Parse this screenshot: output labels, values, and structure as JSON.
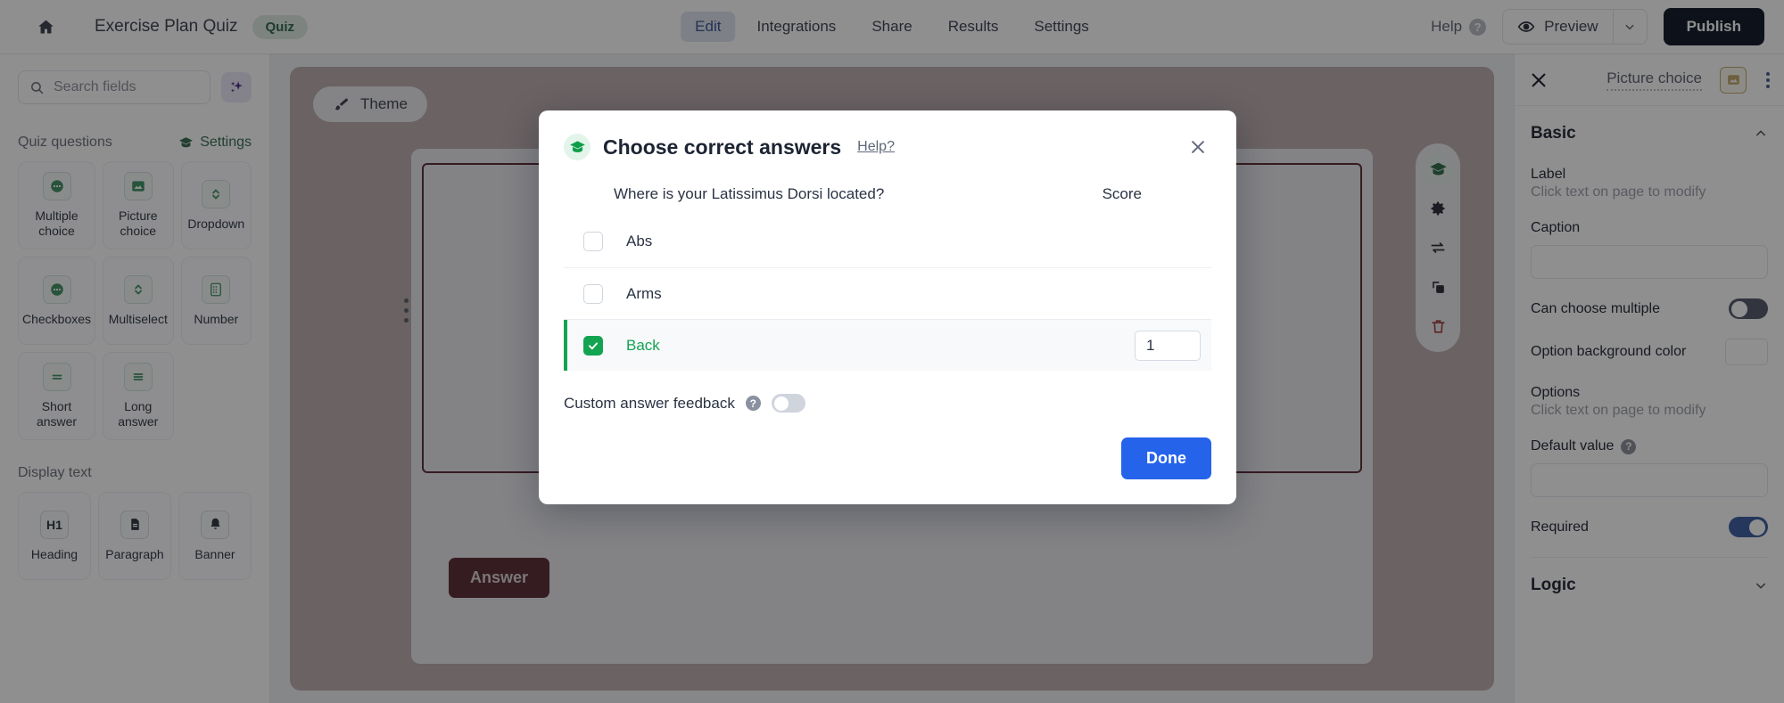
{
  "topbar": {
    "home_icon": "home-icon",
    "doc_title": "Exercise Plan Quiz",
    "badge": "Quiz",
    "tabs": [
      {
        "label": "Edit",
        "active": true
      },
      {
        "label": "Integrations",
        "active": false
      },
      {
        "label": "Share",
        "active": false
      },
      {
        "label": "Results",
        "active": false
      },
      {
        "label": "Settings",
        "active": false
      }
    ],
    "help_label": "Help",
    "help_icon": "question-circle-icon",
    "preview_label": "Preview",
    "preview_icon": "eye-icon",
    "preview_caret_icon": "chevron-down-icon",
    "publish_label": "Publish"
  },
  "sidebar": {
    "search_placeholder": "Search fields",
    "search_icon": "search-icon",
    "ai_icon": "sparkles-icon",
    "quiz_section_title": "Quiz questions",
    "settings_label": "Settings",
    "settings_icon": "graduation-cap-icon",
    "quiz_fields": [
      {
        "label": "Multiple choice",
        "icon": "dots-circle-icon",
        "tone": "green"
      },
      {
        "label": "Picture choice",
        "icon": "image-icon",
        "tone": "green"
      },
      {
        "label": "Dropdown",
        "icon": "chevron-updown-icon",
        "tone": "green"
      },
      {
        "label": "Checkboxes",
        "icon": "dots-circle-icon",
        "tone": "green"
      },
      {
        "label": "Multiselect",
        "icon": "chevron-updown-icon",
        "tone": "green"
      },
      {
        "label": "Number",
        "icon": "numpad-icon",
        "tone": "green"
      },
      {
        "label": "Short answer",
        "icon": "equals-icon",
        "tone": "green"
      },
      {
        "label": "Long answer",
        "icon": "lines-icon",
        "tone": "green"
      }
    ],
    "display_section_title": "Display text",
    "display_fields": [
      {
        "label": "Heading",
        "icon": "h1-icon",
        "tone": "dark"
      },
      {
        "label": "Paragraph",
        "icon": "document-icon",
        "tone": "dark"
      },
      {
        "label": "Banner",
        "icon": "bell-icon",
        "tone": "dark"
      }
    ]
  },
  "canvas": {
    "theme_label": "Theme",
    "theme_icon": "paintbrush-icon",
    "answer_button": "Answer",
    "drag_handle_icon": "drag-dots-icon",
    "tools": [
      {
        "icon": "graduation-cap-icon",
        "active": true
      },
      {
        "icon": "gear-icon",
        "active": false
      },
      {
        "icon": "swap-arrows-icon",
        "active": false
      },
      {
        "icon": "duplicate-icon",
        "active": false
      },
      {
        "icon": "trash-icon",
        "active": false
      }
    ]
  },
  "right_panel": {
    "close_icon": "close-icon",
    "field_type": "Picture choice",
    "field_type_icon": "image-icon",
    "kebab_icon": "kebab-menu-icon",
    "basic_section": "Basic",
    "basic_collapse_icon": "chevron-up-icon",
    "label_title": "Label",
    "label_hint": "Click text on page to modify",
    "caption_title": "Caption",
    "caption_value": "",
    "can_choose_multiple": "Can choose multiple",
    "can_choose_multiple_on": false,
    "option_bg_color": "Option background color",
    "option_bg_swatch": "#ffffff",
    "options_title": "Options",
    "options_hint": "Click text on page to modify",
    "default_value_title": "Default value",
    "default_value_help_icon": "question-circle-icon",
    "default_value": "",
    "required_label": "Required",
    "required_on": true,
    "logic_section": "Logic",
    "logic_collapse_icon": "chevron-down-icon"
  },
  "modal": {
    "logo_icon": "graduation-cap-icon",
    "title": "Choose correct answers",
    "help_link": "Help?",
    "close_icon": "close-icon",
    "question": "Where is your Latissimus Dorsi located?",
    "score_header": "Score",
    "options": [
      {
        "label": "Abs",
        "checked": false,
        "score": ""
      },
      {
        "label": "Arms",
        "checked": false,
        "score": ""
      },
      {
        "label": "Back",
        "checked": true,
        "score": "1"
      }
    ],
    "custom_feedback_label": "Custom answer feedback",
    "custom_feedback_help_icon": "question-circle-icon",
    "custom_feedback_on": false,
    "done_label": "Done"
  },
  "colors": {
    "accent_blue": "#2563eb",
    "accent_green": "#13a452",
    "publish_dark": "#101d34",
    "badge_green_text": "#157347",
    "quiz_settings_green": "#1a7a46",
    "ai_purple": "#5b2fc9",
    "type_icon_gold": "#d8a93a",
    "delete_red": "#d93025"
  }
}
